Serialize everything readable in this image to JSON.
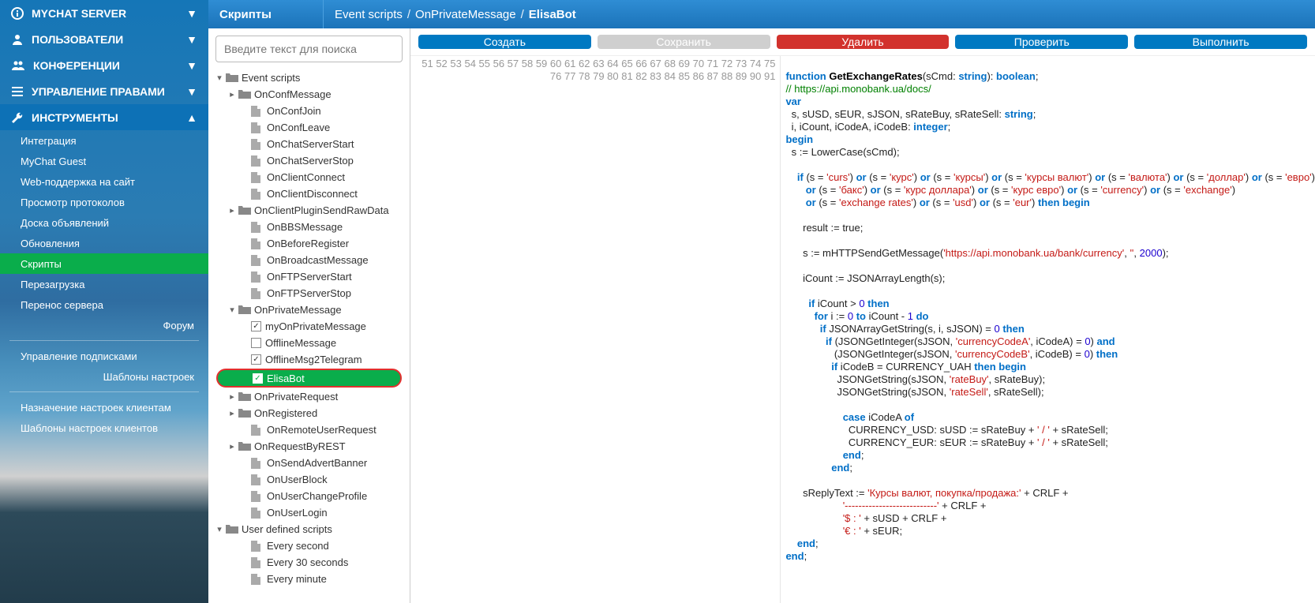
{
  "sidebar": {
    "sections": [
      {
        "id": "mychat",
        "label": "MYCHAT SERVER",
        "icon": "info"
      },
      {
        "id": "users",
        "label": "ПОЛЬЗОВАТЕЛИ",
        "icon": "user"
      },
      {
        "id": "conf",
        "label": "КОНФЕРЕНЦИИ",
        "icon": "users"
      },
      {
        "id": "rights",
        "label": "УПРАВЛЕНИЕ ПРАВАМИ",
        "icon": "list"
      },
      {
        "id": "tools",
        "label": "ИНСТРУМЕНТЫ",
        "icon": "wrench",
        "open": true
      }
    ],
    "tools_sub": [
      "Интеграция",
      "MyChat Guest",
      "Web-поддержка на сайт",
      "Просмотр протоколов",
      "Доска объявлений",
      "Обновления",
      "Скрипты",
      "Перезагрузка",
      "Перенос сервера"
    ],
    "tools_active": "Скрипты",
    "forum": "Форум",
    "extra": [
      "Управление подписками"
    ],
    "extra_right": "Шаблоны настроек",
    "extra2": [
      "Назначение настроек клиентам",
      "Шаблоны настроек клиентов"
    ]
  },
  "topbar": {
    "title": "Скрипты",
    "crumbs": [
      "Event scripts",
      "OnPrivateMessage",
      "ElisaBot"
    ]
  },
  "search_placeholder": "Введите текст для поиска",
  "tree": [
    {
      "d": 0,
      "t": "folder",
      "exp": "-",
      "label": "Event scripts"
    },
    {
      "d": 1,
      "t": "folder",
      "exp": "+",
      "label": "OnConfMessage"
    },
    {
      "d": 2,
      "t": "file",
      "label": "OnConfJoin"
    },
    {
      "d": 2,
      "t": "file",
      "label": "OnConfLeave"
    },
    {
      "d": 2,
      "t": "file",
      "label": "OnChatServerStart"
    },
    {
      "d": 2,
      "t": "file",
      "label": "OnChatServerStop"
    },
    {
      "d": 2,
      "t": "file",
      "label": "OnClientConnect"
    },
    {
      "d": 2,
      "t": "file",
      "label": "OnClientDisconnect"
    },
    {
      "d": 1,
      "t": "folder",
      "exp": "+",
      "label": "OnClientPluginSendRawData"
    },
    {
      "d": 2,
      "t": "file",
      "label": "OnBBSMessage"
    },
    {
      "d": 2,
      "t": "file",
      "label": "OnBeforeRegister"
    },
    {
      "d": 2,
      "t": "file",
      "label": "OnBroadcastMessage"
    },
    {
      "d": 2,
      "t": "file",
      "label": "OnFTPServerStart"
    },
    {
      "d": 2,
      "t": "file",
      "label": "OnFTPServerStop"
    },
    {
      "d": 1,
      "t": "folder",
      "exp": "-",
      "label": "OnPrivateMessage"
    },
    {
      "d": 2,
      "t": "chk",
      "checked": true,
      "label": "myOnPrivateMessage"
    },
    {
      "d": 2,
      "t": "chk",
      "checked": false,
      "label": "OfflineMessage"
    },
    {
      "d": 2,
      "t": "chk",
      "checked": true,
      "label": "OfflineMsg2Telegram"
    },
    {
      "d": 2,
      "t": "chk",
      "checked": true,
      "label": "ElisaBot",
      "selected": true
    },
    {
      "d": 1,
      "t": "folder",
      "exp": "+",
      "label": "OnPrivateRequest"
    },
    {
      "d": 1,
      "t": "folder",
      "exp": "+",
      "label": "OnRegistered"
    },
    {
      "d": 2,
      "t": "file",
      "label": "OnRemoteUserRequest"
    },
    {
      "d": 1,
      "t": "folder",
      "exp": "+",
      "label": "OnRequestByREST"
    },
    {
      "d": 2,
      "t": "file",
      "label": "OnSendAdvertBanner"
    },
    {
      "d": 2,
      "t": "file",
      "label": "OnUserBlock"
    },
    {
      "d": 2,
      "t": "file",
      "label": "OnUserChangeProfile"
    },
    {
      "d": 2,
      "t": "file",
      "label": "OnUserLogin"
    },
    {
      "d": 0,
      "t": "folder",
      "exp": "-",
      "label": "User defined scripts"
    },
    {
      "d": 2,
      "t": "file",
      "label": "Every second"
    },
    {
      "d": 2,
      "t": "file",
      "label": "Every 30 seconds"
    },
    {
      "d": 2,
      "t": "file",
      "label": "Every minute"
    }
  ],
  "buttons": {
    "create": "Создать",
    "save": "Сохранить",
    "delete": "Удалить",
    "check": "Проверить",
    "run": "Выполнить"
  },
  "code": {
    "start": 51,
    "html": "\n<span class='kw'>function</span> <span class='fn'>GetExchangeRates</span>(sCmd: <span class='ty'>string</span>): <span class='ty'>boolean</span>;\n<span class='cm'>// https://api.monobank.ua/docs/</span>\n<span class='kw'>var</span>\n  s, sUSD, sEUR, sJSON, sRateBuy, sRateSell: <span class='ty'>string</span>;\n  i, iCount, iCodeA, iCodeB: <span class='ty'>integer</span>;\n<span class='kw'>begin</span>\n  s := LowerCase(sCmd);\n\n    <span class='kw'>if</span> (s = <span class='st'>'curs'</span>) <span class='kw'>or</span> (s = <span class='st'>'курс'</span>) <span class='kw'>or</span> (s = <span class='st'>'курсы'</span>) <span class='kw'>or</span> (s = <span class='st'>'курсы валют'</span>) <span class='kw'>or</span> (s = <span class='st'>'валюта'</span>) <span class='kw'>or</span> (s = <span class='st'>'доллар'</span>) <span class='kw'>or</span> (s = <span class='st'>'евро'</span>)\n       <span class='kw'>or</span> (s = <span class='st'>'бакс'</span>) <span class='kw'>or</span> (s = <span class='st'>'курс доллара'</span>) <span class='kw'>or</span> (s = <span class='st'>'курс евро'</span>) <span class='kw'>or</span> (s = <span class='st'>'currency'</span>) <span class='kw'>or</span> (s = <span class='st'>'exchange'</span>)\n       <span class='kw'>or</span> (s = <span class='st'>'exchange rates'</span>) <span class='kw'>or</span> (s = <span class='st'>'usd'</span>) <span class='kw'>or</span> (s = <span class='st'>'eur'</span>) <span class='kw'>then begin</span>\n\n      result := true;\n\n      s := mHTTPSendGetMessage(<span class='st'>'https://api.monobank.ua/bank/currency'</span>, <span class='st'>''</span>, <span class='nu'>2000</span>);\n\n      iCount := JSONArrayLength(s);\n\n        <span class='kw'>if</span> iCount &gt; <span class='nu'>0</span> <span class='kw'>then</span>\n          <span class='kw'>for</span> i := <span class='nu'>0</span> <span class='kw'>to</span> iCount - <span class='nu'>1</span> <span class='kw'>do</span>\n            <span class='kw'>if</span> JSONArrayGetString(s, i, sJSON) = <span class='nu'>0</span> <span class='kw'>then</span>\n              <span class='kw'>if</span> (JSONGetInteger(sJSON, <span class='st'>'currencyCodeA'</span>, iCodeA) = <span class='nu'>0</span>) <span class='kw'>and</span>\n                 (JSONGetInteger(sJSON, <span class='st'>'currencyCodeB'</span>, iCodeB) = <span class='nu'>0</span>) <span class='kw'>then</span>\n                <span class='kw'>if</span> iCodeB = CURRENCY_UAH <span class='kw'>then begin</span>\n                  JSONGetString(sJSON, <span class='st'>'rateBuy'</span>, sRateBuy);\n                  JSONGetString(sJSON, <span class='st'>'rateSell'</span>, sRateSell);\n\n                    <span class='kw'>case</span> iCodeA <span class='kw'>of</span>\n                      CURRENCY_USD: sUSD := sRateBuy + <span class='st'>' / '</span> + sRateSell;\n                      CURRENCY_EUR: sEUR := sRateBuy + <span class='st'>' / '</span> + sRateSell;\n                    <span class='kw'>end</span>;\n                <span class='kw'>end</span>;\n\n      sReplyText := <span class='st'>'Курсы валют, покупка/продажа:'</span> + CRLF +\n                    <span class='st'>'---------------------------'</span> + CRLF +\n                    <span class='st'>'$ : '</span> + sUSD + CRLF +\n                    <span class='st'>'€ : '</span> + sEUR;\n    <span class='kw'>end</span>;\n<span class='kw'>end</span>;\n"
  }
}
